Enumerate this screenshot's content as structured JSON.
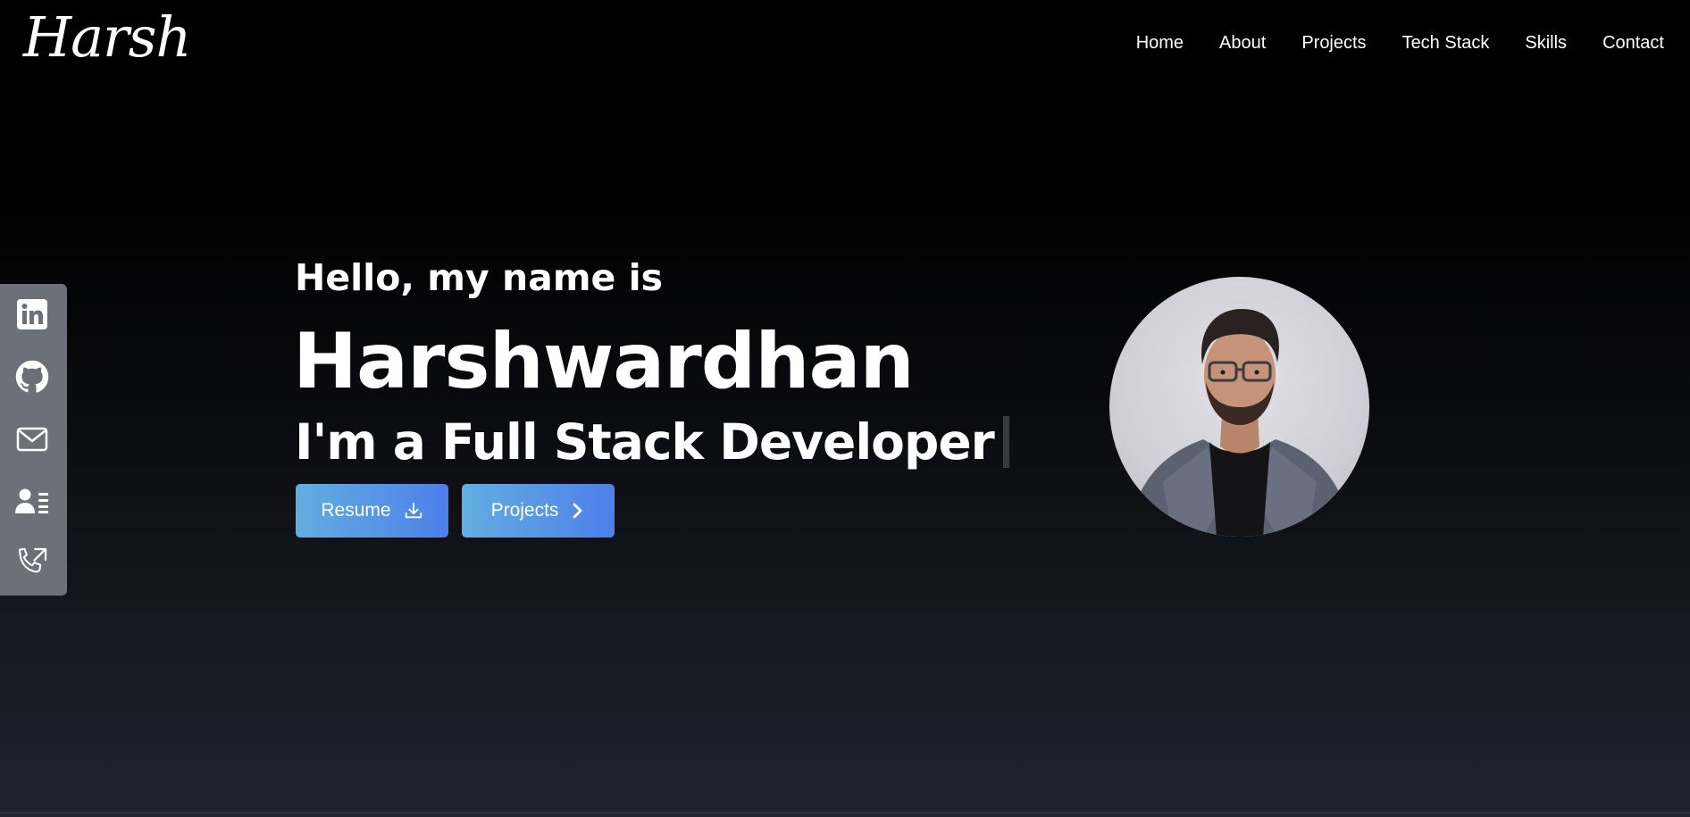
{
  "brand": {
    "logo_text": "Harsh"
  },
  "nav": {
    "items": [
      "Home",
      "About",
      "Projects",
      "Tech Stack",
      "Skills",
      "Contact"
    ]
  },
  "social": {
    "icons": [
      "linkedin-icon",
      "github-icon",
      "mail-icon",
      "contact-card-icon",
      "phone-outgoing-icon"
    ]
  },
  "hero": {
    "greeting": "Hello, my name is",
    "name": "Harshwardhan",
    "role": "I'm a Full Stack Developer",
    "buttons": {
      "resume": "Resume",
      "projects": "Projects"
    }
  },
  "colors": {
    "background_top": "#000000",
    "background_bottom": "#1f2430",
    "sidebar": "#6b7079",
    "button_gradient_start": "#62aee0",
    "button_gradient_end": "#4e7fea"
  }
}
